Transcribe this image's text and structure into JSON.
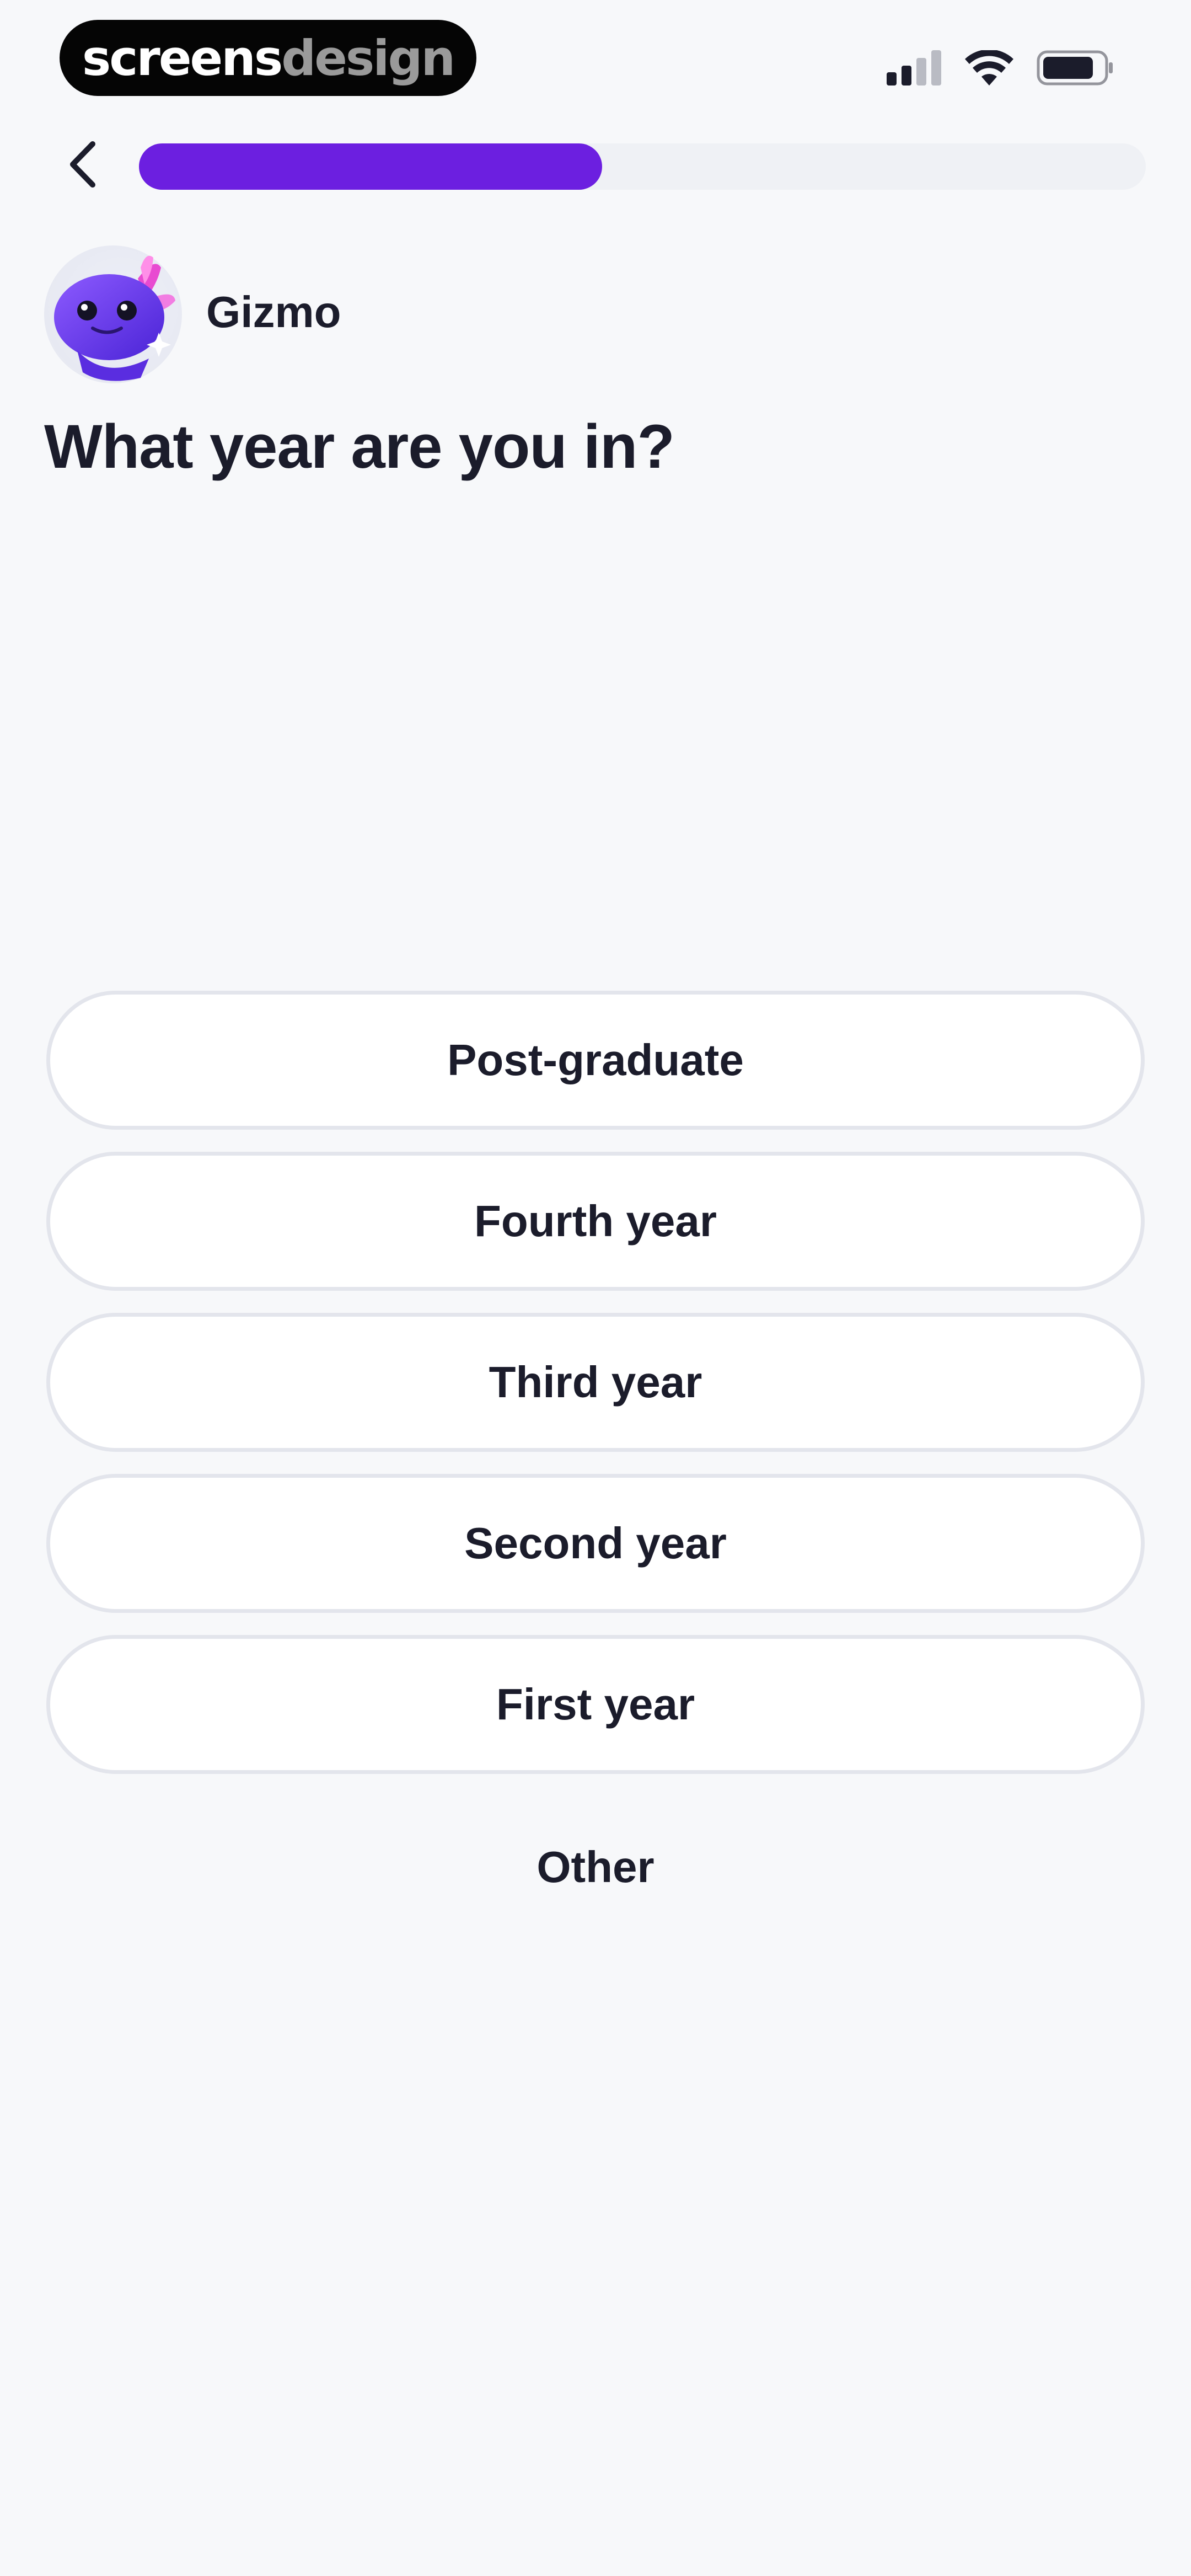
{
  "watermark": {
    "part1": "screens",
    "part2": "design"
  },
  "header": {
    "progress": 0.46
  },
  "mascot": {
    "name": "Gizmo"
  },
  "question": "What year are you in?",
  "options": [
    {
      "label": "Post-graduate"
    },
    {
      "label": "Fourth year"
    },
    {
      "label": "Third year"
    },
    {
      "label": "Second year"
    },
    {
      "label": "First year"
    }
  ],
  "other_label": "Other",
  "colors": {
    "accent": "#6c1fe0",
    "track": "#eff1f5",
    "background": "#f7f8fa",
    "text": "#1b1c2b",
    "border": "#e3e5ec"
  },
  "icons": {
    "back": "chevron-left-icon",
    "signal": "cellular-signal-icon",
    "wifi": "wifi-icon",
    "battery": "battery-icon"
  }
}
